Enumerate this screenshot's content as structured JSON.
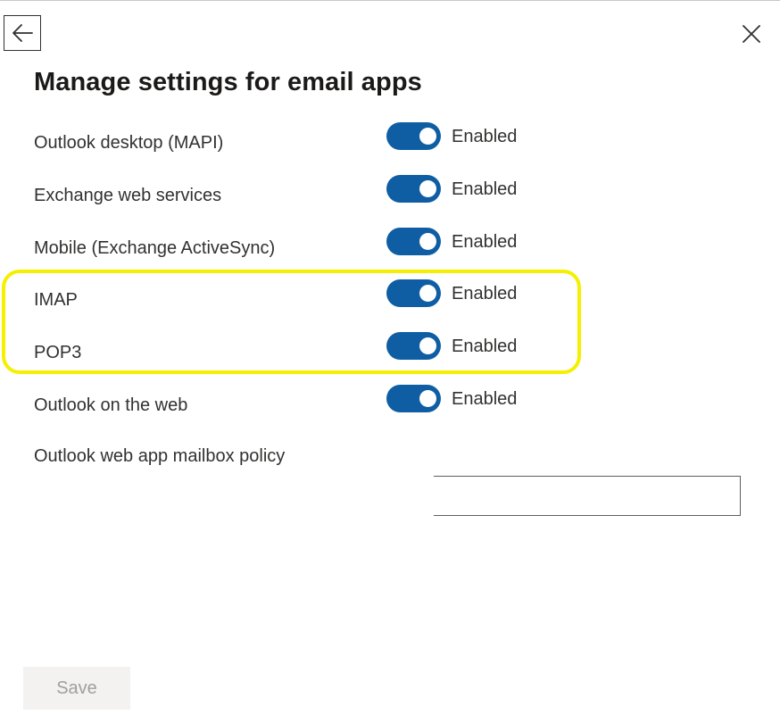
{
  "header": {
    "back_icon": "arrow-left-icon",
    "close_icon": "close-icon"
  },
  "title": "Manage settings for email apps",
  "settings": [
    {
      "label": "Outlook desktop (MAPI)",
      "state": "Enabled",
      "enabled": true
    },
    {
      "label": "Exchange web services",
      "state": "Enabled",
      "enabled": true
    },
    {
      "label": "Mobile (Exchange ActiveSync)",
      "state": "Enabled",
      "enabled": true
    },
    {
      "label": "IMAP",
      "state": "Enabled",
      "enabled": true
    },
    {
      "label": "POP3",
      "state": "Enabled",
      "enabled": true
    },
    {
      "label": "Outlook on the web",
      "state": "Enabled",
      "enabled": true
    }
  ],
  "policy": {
    "label": "Outlook web app mailbox policy",
    "value": ""
  },
  "footer": {
    "save_label": "Save"
  },
  "colors": {
    "toggle_on": "#0f5ea4",
    "highlight": "#f5ef00",
    "save_disabled_bg": "#f3f2f1",
    "save_disabled_text": "#a19f9d"
  }
}
